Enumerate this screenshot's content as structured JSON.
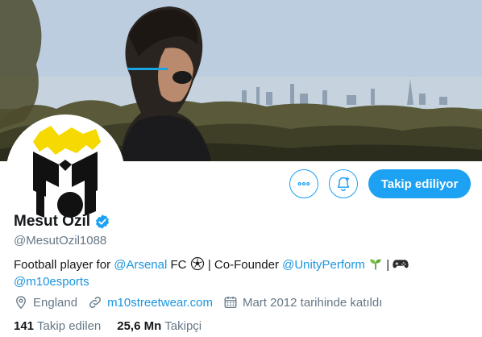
{
  "profile": {
    "display_name": "Mesut Özil",
    "handle": "@MesutOzil1088",
    "verified": true,
    "bio": {
      "text_1": "Football player for ",
      "mention_1": "@Arsenal",
      "text_2": " FC ",
      "text_3": " | Co-Founder ",
      "mention_2": "@UnityPerform",
      "text_4": " | ",
      "mention_3": "@m10esports"
    },
    "location": "England",
    "website": "m10streetwear.com",
    "joined": "Mart 2012 tarihinde katıldı"
  },
  "stats": {
    "following_count": "141",
    "following_label": "Takip edilen",
    "followers_count": "25,6 Mn",
    "followers_label": "Takipçi"
  },
  "actions": {
    "follow_label": "Takip ediliyor"
  },
  "icons": {
    "more": "more-icon",
    "bell": "notification-bell-icon",
    "verified": "verified-badge-icon",
    "location": "location-pin-icon",
    "link": "link-icon",
    "calendar": "calendar-icon",
    "soccer": "soccer-ball-emoji",
    "seedling": "seedling-emoji",
    "gamepad": "game-controller-emoji"
  },
  "colors": {
    "accent": "#1da1f2",
    "link": "#1b95e0",
    "muted": "#657786",
    "text": "#14171a"
  }
}
